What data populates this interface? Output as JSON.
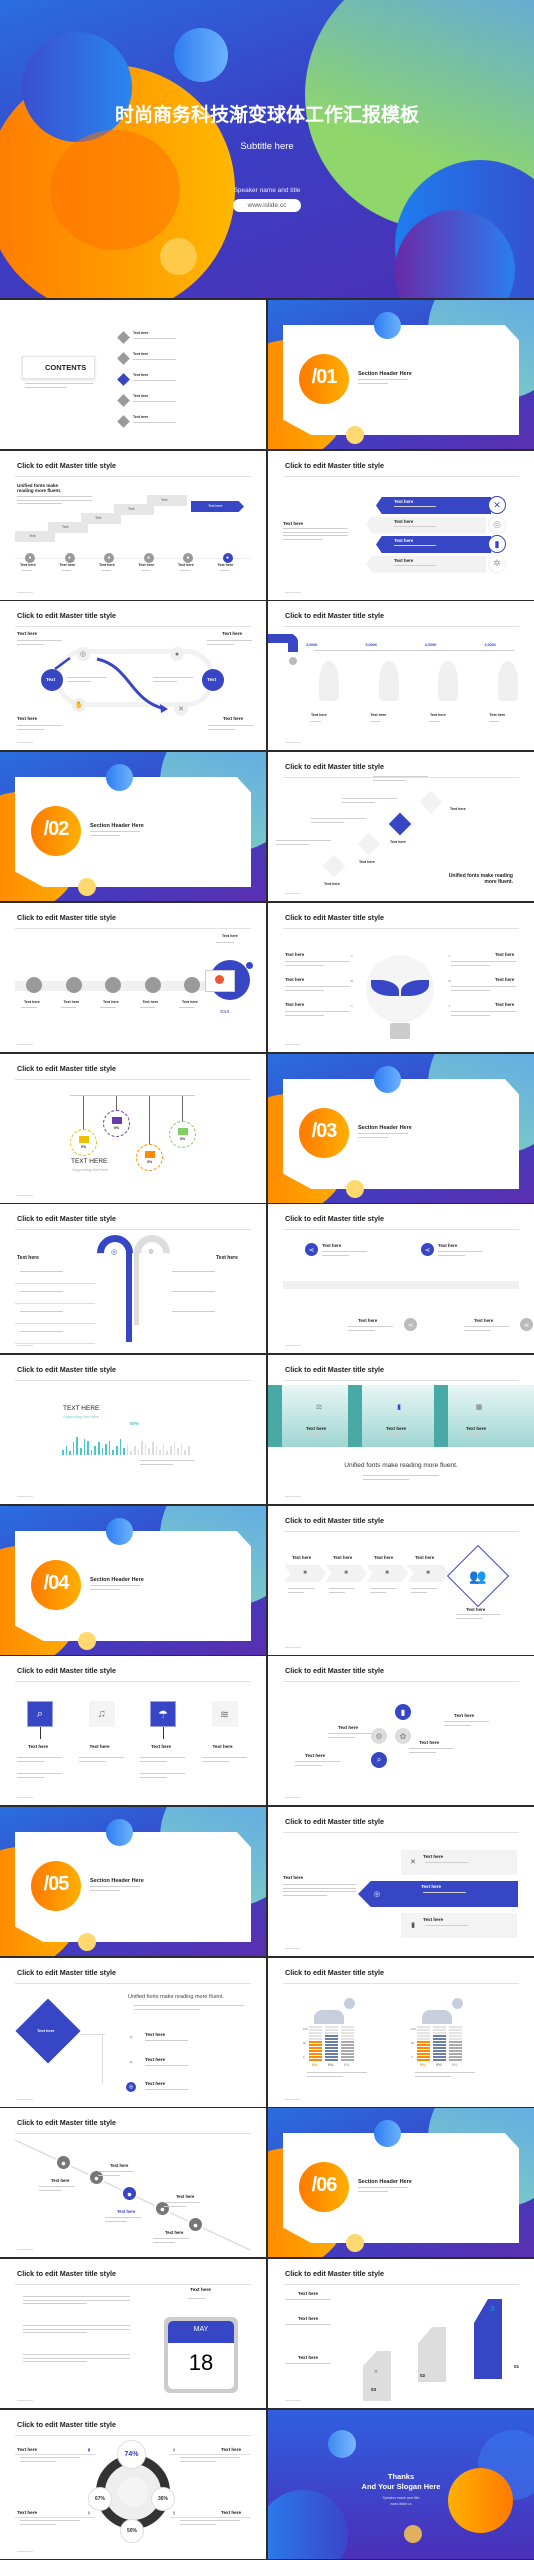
{
  "colors": {
    "brand_blue": "#3646c4",
    "orange": "#ff8a00",
    "yellow": "#ffc21a",
    "teal": "#4cc7c9",
    "gray": "#9a9a9a"
  },
  "title_slide": {
    "title": "时尚商务科技渐变球体工作汇报模板",
    "subtitle": "Subtitle here",
    "speaker": "Speaker name  and title",
    "website": "www.islide.cc"
  },
  "master_title": "Click to edit Master title style",
  "slides": [
    {
      "type": "contents",
      "heading": "CONTENTS",
      "items": [
        {
          "num": "01",
          "title": "Text here"
        },
        {
          "num": "02",
          "title": "Text here"
        },
        {
          "num": "03",
          "title": "Text here"
        },
        {
          "num": "04",
          "title": "Text here"
        },
        {
          "num": "05",
          "title": "Text here"
        }
      ]
    },
    {
      "type": "section",
      "number": "/01",
      "header": "Section Header Here"
    },
    {
      "type": "steps",
      "heading": "Unified fonts make reading more fluent.",
      "banner": "Text here",
      "steps": [
        "Text",
        "Text",
        "Text",
        "Text",
        "Text"
      ],
      "labels": [
        "Text here",
        "Text here",
        "Text here",
        "Text here",
        "Text here",
        "Text here"
      ],
      "icons": [
        "briefcase-icon",
        "search-icon",
        "compass-icon",
        "cloud-icon",
        "user-icon",
        "chat-icon"
      ]
    },
    {
      "type": "ribbons",
      "left_title": "Text here",
      "items": [
        "Text here",
        "Text here",
        "Text here",
        "Text here"
      ],
      "icons": [
        "tools-icon",
        "target-icon",
        "chart-icon",
        "gear-icon"
      ]
    },
    {
      "type": "loop",
      "corners": [
        "Text here",
        "Text here",
        "Text here",
        "Text here"
      ],
      "circles": [
        "Text",
        "Text"
      ]
    },
    {
      "type": "faucet",
      "values": [
        "3,000K",
        "5,000K",
        "6,000K",
        "2,000K"
      ],
      "labels": [
        "Text here",
        "Text here",
        "Text here",
        "Text here"
      ]
    },
    {
      "type": "section",
      "number": "/02",
      "header": "Section Header Here"
    },
    {
      "type": "diamonds",
      "labels": [
        "Text here",
        "Text here",
        "Text here",
        "Text here"
      ],
      "tagline": "Unified fonts make reading more fluent."
    },
    {
      "type": "timeline",
      "top_label": "Text here",
      "labels": [
        "Text here",
        "Text here",
        "Text here",
        "Text here",
        "Text here"
      ],
      "year": "2019"
    },
    {
      "type": "bulb",
      "left": [
        "Text here",
        "Text here",
        "Text here"
      ],
      "right": [
        "Text here",
        "Text here",
        "Text here"
      ]
    },
    {
      "type": "hanging",
      "heading": "TEXT HERE",
      "sub": "Supporting text here",
      "pcts": [
        "0%",
        "0%",
        "0%",
        "0%"
      ]
    },
    {
      "type": "section",
      "number": "/03",
      "header": "Section Header Here"
    },
    {
      "type": "hook",
      "left": "Text here",
      "right": "Text here"
    },
    {
      "type": "timeline2",
      "labels": [
        "Text here",
        "Text here",
        "Text here",
        "Text here"
      ]
    },
    {
      "type": "bars",
      "heading": "TEXT HERE",
      "sub": "Supporting text here",
      "pct": "55%",
      "bar_levels": [
        0.3,
        0.5,
        0.2,
        0.7,
        1,
        0.4,
        0.9,
        0.8,
        0.3,
        0.5,
        0.7,
        0.4,
        0.6,
        0.8,
        0.3,
        0.5,
        0.9,
        0.4,
        0.6,
        0.2,
        0.5,
        0.3,
        0.8,
        0.6,
        0.4,
        0.7,
        0.5,
        0.3,
        0.6,
        0.2,
        0.5,
        0.7,
        0.4,
        0.6,
        0.3,
        0.5
      ]
    },
    {
      "type": "teal",
      "labels": [
        "Text here",
        "Text here",
        "Text here"
      ],
      "tagline": "Unified fonts make reading more fluent."
    },
    {
      "type": "section",
      "number": "/04",
      "header": "Section Header Here"
    },
    {
      "type": "process",
      "labels": [
        "Text here",
        "Text here",
        "Text here",
        "Text here"
      ],
      "diamond_label": "Text here"
    },
    {
      "type": "squares",
      "labels": [
        "Text here",
        "Text here",
        "Text here",
        "Text here"
      ],
      "icons": [
        "search-icon",
        "music-icon",
        "umbrella-icon",
        "wifi-icon"
      ]
    },
    {
      "type": "circles",
      "labels": [
        "Text here",
        "Text here",
        "Text here",
        "Text here"
      ]
    },
    {
      "type": "section",
      "number": "/05",
      "header": "Section Header Here"
    },
    {
      "type": "ribbon2",
      "left_title": "Text here",
      "items": [
        "Text here",
        "Text here",
        "Text here"
      ]
    },
    {
      "type": "diamond",
      "center": "Text here",
      "tagline": "Unified fonts make reading more fluent.",
      "items": [
        "Text here",
        "Text here",
        "Text here"
      ]
    },
    {
      "type": "people",
      "axis": [
        "100",
        "50",
        "0"
      ],
      "groups": [
        {
          "pcts": [
            "0%",
            "0%",
            "0%"
          ]
        },
        {
          "pcts": [
            "0%",
            "0%",
            "0%"
          ]
        }
      ]
    },
    {
      "type": "diagonal",
      "labels": [
        "Text here",
        "Text here",
        "Text here",
        "Text here",
        "Text here"
      ]
    },
    {
      "type": "section",
      "number": "/06",
      "header": "Section Header Here"
    },
    {
      "type": "calendar",
      "label": "Text here",
      "month": "MAY",
      "day": "18"
    },
    {
      "type": "arrows",
      "labels": [
        "Text here",
        "Text here",
        "Text here"
      ],
      "nums": [
        "01",
        "02",
        "03"
      ]
    },
    {
      "type": "donut",
      "pcts": [
        "74%",
        "67%",
        "36%",
        "50%"
      ],
      "labels": [
        "Text here",
        "Text here",
        "Text here",
        "Text here"
      ]
    },
    {
      "type": "thanks",
      "line1": "Thanks",
      "line2": "And Your Slogan Here",
      "speaker": "Speaker name and title",
      "website": "www.islide.cc"
    }
  ]
}
